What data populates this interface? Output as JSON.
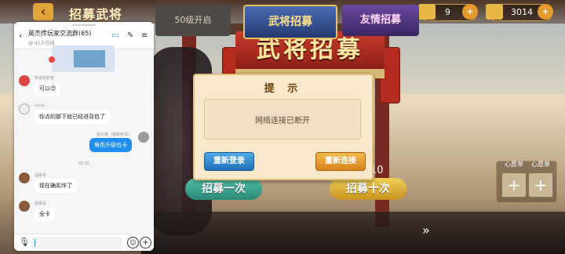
{
  "game": {
    "screen_title": "招募武将",
    "resources": [
      {
        "icon": "ticket-icon",
        "value": "9"
      },
      {
        "icon": "gold-ingot-icon",
        "value": "3014"
      }
    ],
    "banner_title": "武将招募",
    "recruit_one_label": "招募一次",
    "recruit_ten_label": "招募十次",
    "ten_count_hint": "10",
    "slot_labels": [
      "心愿单",
      "心愿单"
    ],
    "bottom_tabs": {
      "locked": "50级开启",
      "general": "武将招募",
      "friend": "友情招募"
    },
    "dialog": {
      "title": "提 示",
      "message": "网络连接已断开",
      "relogin": "重新登录",
      "reconnect": "重新连接"
    }
  },
  "chat": {
    "group_name": "英杰传玩家交流群(65)",
    "group_sub": "@ 41人在线",
    "messages": [
      {
        "sender": "传说骑驴客",
        "text": "可以😊"
      },
      {
        "sender": "tacos",
        "text": "你点的那下就已经进背包了"
      },
      {
        "sender": "提示者（客服老师）",
        "text": "角色升级也卡",
        "mine": true
      },
      {
        "timestamp": "16:55"
      },
      {
        "sender": "温柔哥",
        "text": "现在确实炸了"
      },
      {
        "sender": "温柔哥",
        "text": "全卡"
      }
    ],
    "input_placeholder": ""
  },
  "colors": {
    "chat_accent": "#1e8ef0",
    "dialog_bg": "#f6e8c9",
    "relogin_blue": "#2170b8",
    "reconnect_orange": "#d7831c"
  }
}
